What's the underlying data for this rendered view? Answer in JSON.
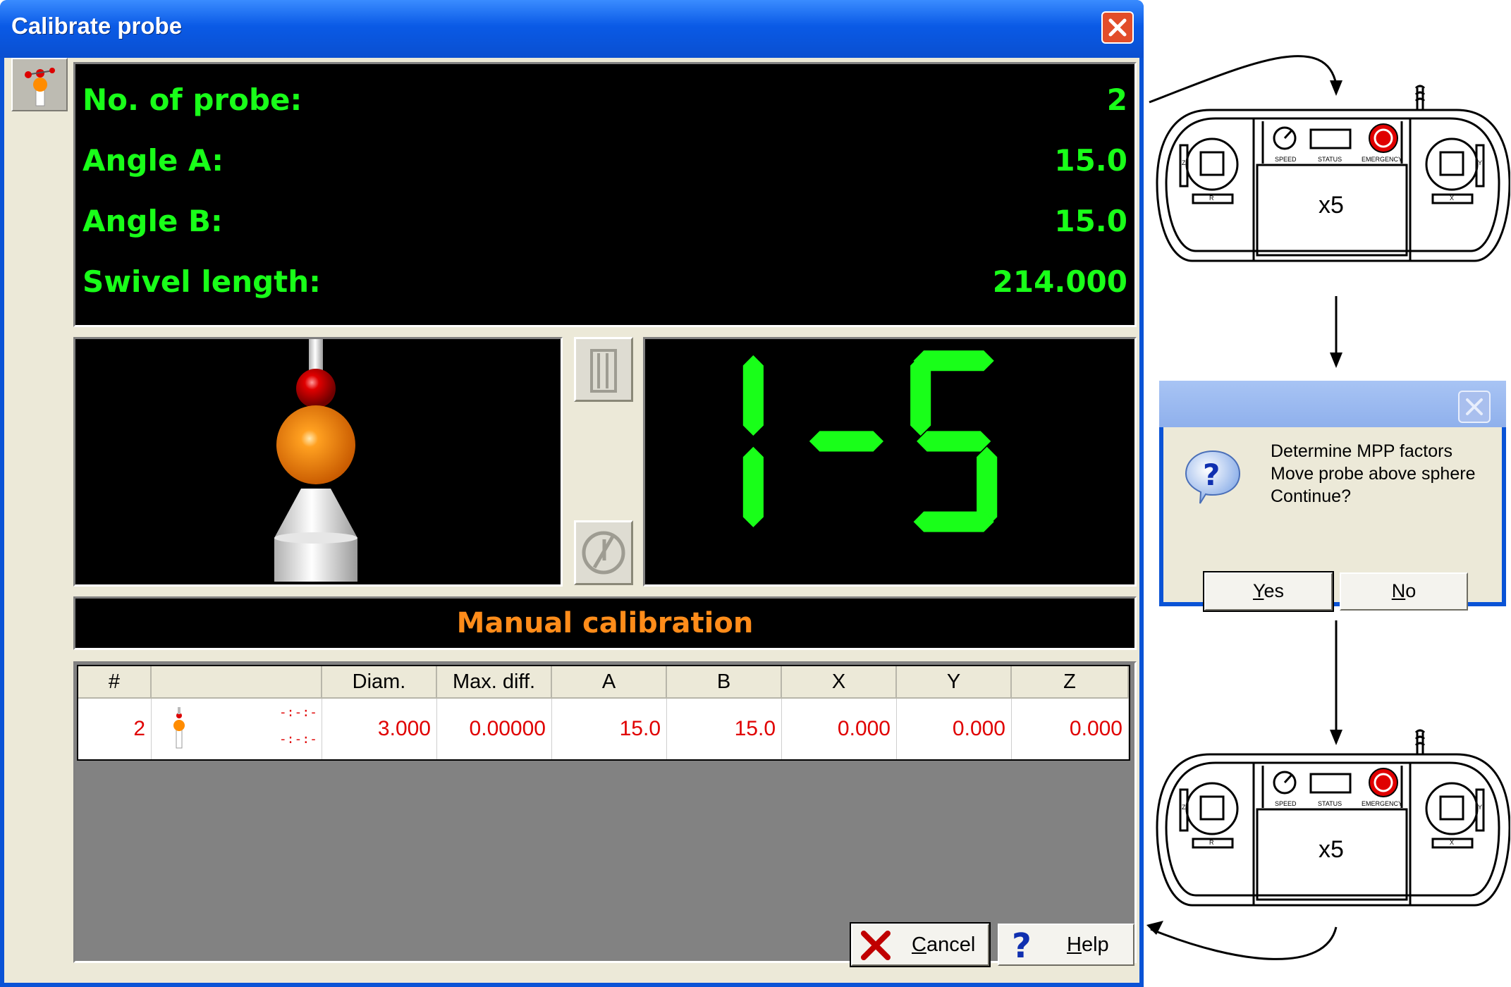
{
  "window": {
    "title": "Calibrate probe"
  },
  "info_panel": {
    "rows": [
      {
        "label": "No. of probe:",
        "value": "2"
      },
      {
        "label": "Angle A:",
        "value": "15.0"
      },
      {
        "label": "Angle B:",
        "value": "15.0"
      },
      {
        "label": "Swivel length:",
        "value": "214.000"
      }
    ],
    "text_color": "#19ff19"
  },
  "digit_display": {
    "text": "1-5",
    "color": "#19ff19"
  },
  "mode": {
    "label": "Manual calibration",
    "color": "#ff8c1a"
  },
  "table": {
    "headers": [
      "#",
      "",
      "Diam.",
      "Max. diff.",
      "A",
      "B",
      "X",
      "Y",
      "Z"
    ],
    "rows": [
      {
        "num": "2",
        "dash_top": "-:-:-",
        "dash_bottom": "-:-:-",
        "diam": "3.000",
        "max_diff": "0.00000",
        "a": "15.0",
        "b": "15.0",
        "x": "0.000",
        "y": "0.000",
        "z": "0.000"
      }
    ]
  },
  "buttons": {
    "cancel_label": "Cancel",
    "cancel_accel": "C",
    "help_label": "Help",
    "help_accel": "H"
  },
  "flow": {
    "pendant_top": {
      "speed": "SPEED",
      "status": "STATUS",
      "emergency": "EMERGENCY",
      "multiplier": "x5",
      "left_axis_z": "Z",
      "left_axis_r": "R",
      "right_axis_y": "Y",
      "right_axis_x": "X"
    },
    "pendant_bottom": {
      "speed": "SPEED",
      "status": "STATUS",
      "emergency": "EMERGENCY",
      "multiplier": "x5",
      "left_axis_z": "Z",
      "left_axis_r": "R",
      "right_axis_y": "Y",
      "right_axis_x": "X"
    },
    "dialog": {
      "lines": [
        "Determine MPP factors",
        "Move probe above sphere",
        "Continue?"
      ],
      "yes_label": "Yes",
      "no_label": "No"
    }
  },
  "icons": [
    "close-icon",
    "probe-icon",
    "probe-rack-icon",
    "probe-reset-icon",
    "cancel-x-icon",
    "help-question-icon",
    "question-bubble-icon"
  ]
}
